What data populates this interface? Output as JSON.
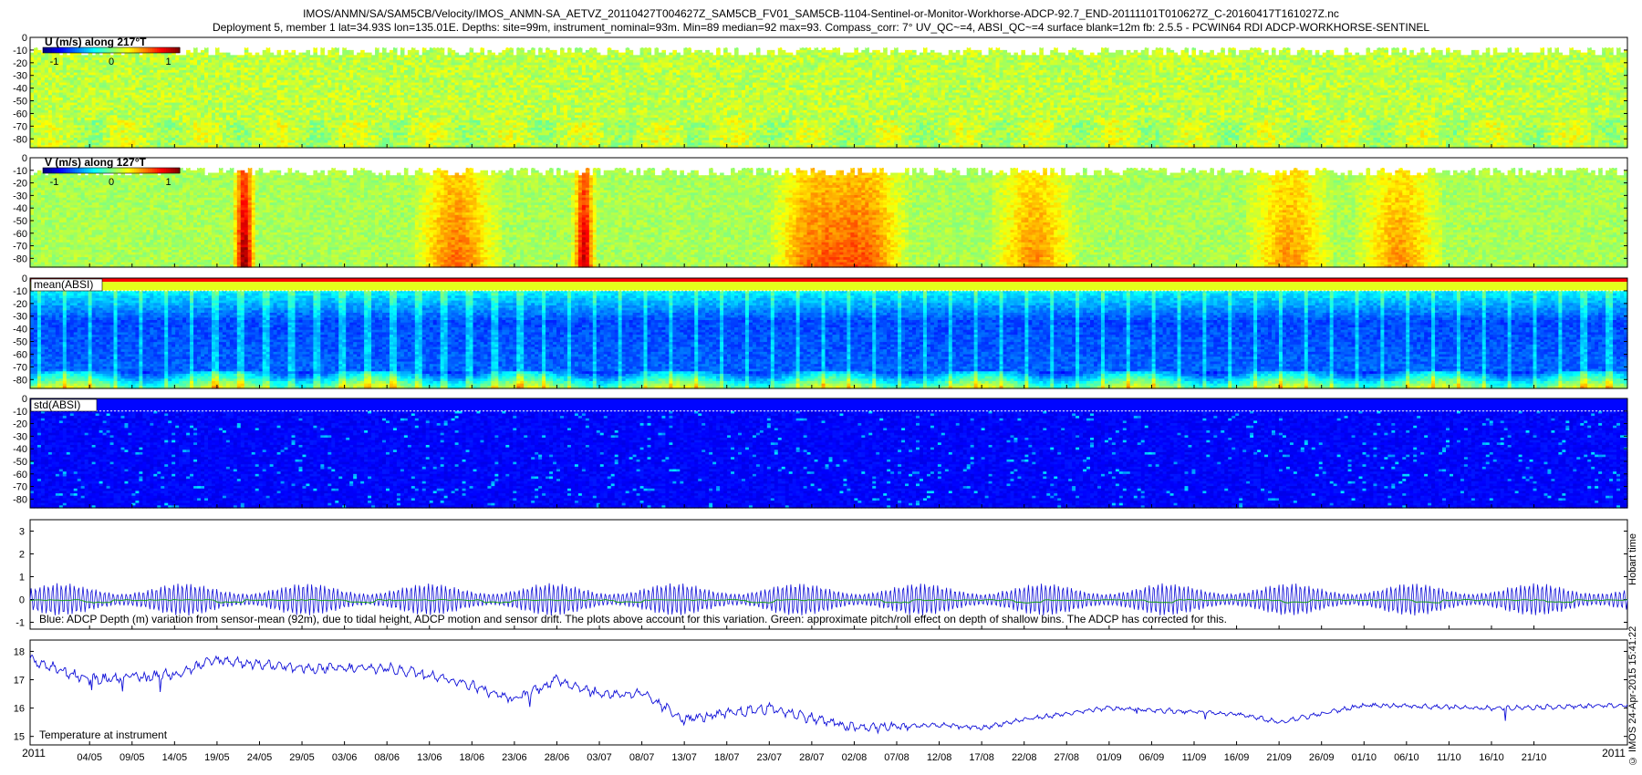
{
  "title": {
    "line1": "IMOS/ANMN/SA/SAM5CB/Velocity/IMOS_ANMN-SA_AETVZ_20110427T004627Z_SAM5CB_FV01_SAM5CB-1104-Sentinel-or-Monitor-Workhorse-ADCP-92.7_END-20111101T010627Z_C-20160417T161027Z.nc",
    "line2": "Deployment 5, member 1 lat=34.93S lon=135.01E. Depths: site=99m, instrument_nominal=93m. Min=89 median=92 max=93. Compass_corr: 7° UV_QC~=4, ABSI_QC~=4 surface blank=12m fb: 2.5.5 - PCWIN64 RDI ADCP-WORKHORSE-SENTINEL"
  },
  "stamp": {
    "right_top": "Hobart time",
    "right_bottom": "© IMOS 24-Apr-2015 15:41:22"
  },
  "colors": {
    "depth_line": "#1010d8",
    "pitch_roll_line": "#18a018",
    "temperature_line": "#1010d8",
    "surface_blank_line": "#ffffff"
  },
  "chart_data": [
    {
      "type": "heatmap",
      "label": "U (m/s) along 217°T",
      "yticks": [
        0,
        -10,
        -20,
        -30,
        -40,
        -50,
        -60,
        -70,
        -80
      ],
      "ylim": [
        -87,
        0
      ],
      "colorbar_ticks": [
        -1,
        0,
        1
      ],
      "colormap": "jet",
      "clim": [
        -1.2,
        1.2
      ],
      "typical_value": 0.15,
      "surface_blank_depth": -8
    },
    {
      "type": "heatmap",
      "label": "V (m/s) along 127°T",
      "yticks": [
        0,
        -10,
        -20,
        -30,
        -40,
        -50,
        -60,
        -70,
        -80
      ],
      "ylim": [
        -87,
        0
      ],
      "colorbar_ticks": [
        -1,
        0,
        1
      ],
      "colormap": "jet",
      "clim": [
        -1.2,
        1.2
      ],
      "high_events": [
        {
          "date": "22/05",
          "value": 1.05
        },
        {
          "date": "16/06",
          "value": 0.55
        },
        {
          "date": "01/07",
          "value": 0.95
        },
        {
          "date": "28/07",
          "value": 0.55
        },
        {
          "date": "03/08",
          "value": 0.6
        },
        {
          "date": "23/08",
          "value": 0.45
        },
        {
          "date": "22/09",
          "value": 0.45
        },
        {
          "date": "05/10",
          "value": 0.45
        }
      ],
      "surface_blank_depth": -8
    },
    {
      "type": "heatmap",
      "label": "mean(ABSI)",
      "yticks": [
        0,
        -10,
        -20,
        -30,
        -40,
        -50,
        -60,
        -70,
        -80
      ],
      "ylim": [
        -87,
        0
      ],
      "colormap": "jet",
      "profile": "high at surface (red), decreasing to low mid-column (dark blue), rising near bottom (cyan/yellow)",
      "surface_blank_depth": -10
    },
    {
      "type": "heatmap",
      "label": "std(ABSI)",
      "yticks": [
        0,
        -10,
        -20,
        -30,
        -40,
        -50,
        -60,
        -70,
        -80
      ],
      "ylim": [
        -87,
        0
      ],
      "colormap": "jet",
      "profile": "mostly low (dark blue) with sparse light-blue streaks",
      "surface_blank_depth": -10
    },
    {
      "type": "line",
      "label": "Blue: ADCP Depth (m) variation from sensor-mean (92m), due to tidal height, ADCP motion and sensor drift. The plots above account for this variation. Green: approximate pitch/roll effect on depth of shallow bins. The ADCP has corrected for this.",
      "yticks": [
        -1,
        0,
        1,
        2,
        3
      ],
      "ylim": [
        -1.3,
        3.5
      ],
      "series": [
        {
          "color_key": "depth_line",
          "baseline": 0,
          "amplitude_range": [
            0.25,
            0.7
          ]
        },
        {
          "color_key": "pitch_roll_line",
          "baseline": 0,
          "amplitude_range": [
            0,
            0.05
          ]
        }
      ]
    },
    {
      "type": "line",
      "label": "Temperature at instrument",
      "yticks": [
        15,
        16,
        17,
        18
      ],
      "ylim": [
        14.7,
        18.4
      ],
      "x": [
        "2011-04-27",
        "2011-05-04",
        "2011-05-14",
        "2011-05-19",
        "2011-05-29",
        "2011-06-08",
        "2011-06-13",
        "2011-06-18",
        "2011-06-23",
        "2011-06-28",
        "2011-07-03",
        "2011-07-08",
        "2011-07-13",
        "2011-07-23",
        "2011-08-02",
        "2011-08-12",
        "2011-08-17",
        "2011-08-22",
        "2011-09-01",
        "2011-09-16",
        "2011-09-21",
        "2011-10-01",
        "2011-10-16",
        "2011-11-01"
      ],
      "series": [
        {
          "color_key": "temperature_line",
          "values": [
            17.7,
            17.0,
            17.2,
            17.7,
            17.4,
            17.4,
            17.2,
            16.8,
            16.3,
            17.0,
            16.5,
            16.5,
            15.6,
            16.0,
            15.3,
            15.4,
            15.3,
            15.6,
            16.0,
            15.8,
            15.5,
            16.1,
            16.0,
            16.1
          ]
        }
      ]
    }
  ],
  "xaxis": {
    "start_label": "2011",
    "end_label": "2011",
    "ticks": [
      "04/05",
      "09/05",
      "14/05",
      "19/05",
      "24/05",
      "29/05",
      "03/06",
      "08/06",
      "13/06",
      "18/06",
      "23/06",
      "28/06",
      "03/07",
      "08/07",
      "13/07",
      "18/07",
      "23/07",
      "28/07",
      "02/08",
      "07/08",
      "12/08",
      "17/08",
      "22/08",
      "27/08",
      "01/09",
      "06/09",
      "11/09",
      "16/09",
      "21/09",
      "26/09",
      "01/10",
      "06/10",
      "11/10",
      "16/10",
      "21/10"
    ]
  }
}
